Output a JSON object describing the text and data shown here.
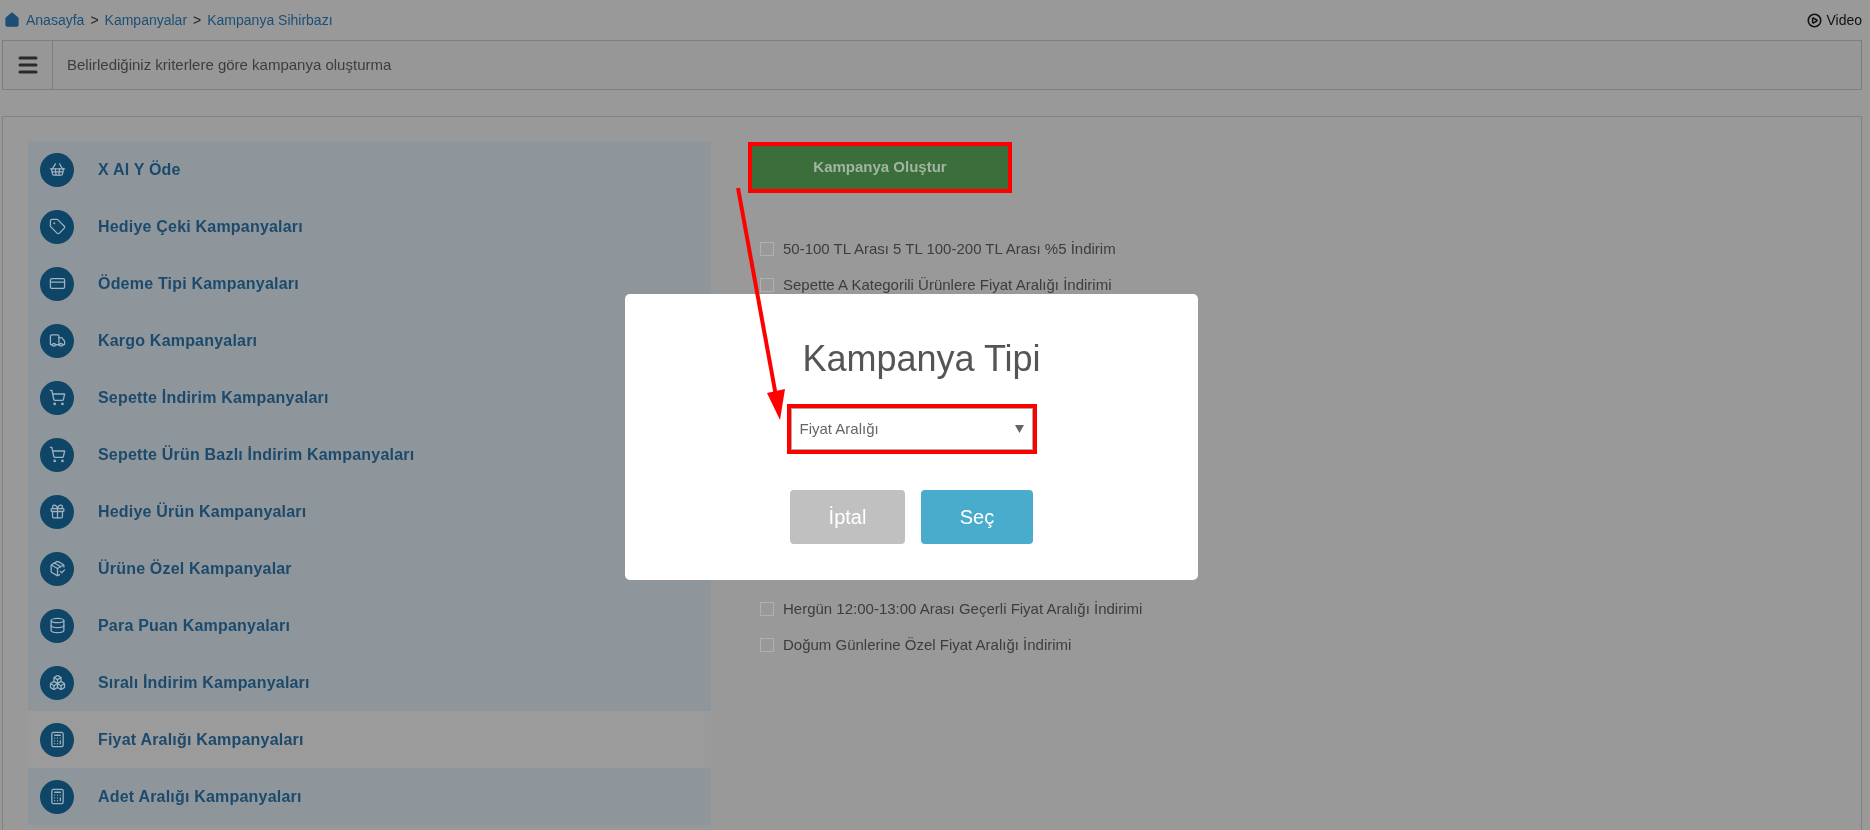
{
  "breadcrumb": [
    {
      "label": "Anasayfa"
    },
    {
      "label": "Kampanyalar"
    },
    {
      "label": "Kampanya Sihirbazı"
    }
  ],
  "breadcrumb_separator": ">",
  "video_link": "Video",
  "header": {
    "title": "Belirlediğiniz kriterlere göre kampanya oluşturma"
  },
  "sidebar": {
    "items": [
      {
        "label": "X Al Y Öde",
        "selected": false
      },
      {
        "label": "Hediye Çeki Kampanyaları",
        "selected": false
      },
      {
        "label": "Ödeme Tipi Kampanyaları",
        "selected": false
      },
      {
        "label": "Kargo Kampanyaları",
        "selected": false
      },
      {
        "label": "Sepette İndirim Kampanyaları",
        "selected": false
      },
      {
        "label": "Sepette Ürün Bazlı İndirim Kampanyaları",
        "selected": false
      },
      {
        "label": "Hediye Ürün Kampanyaları",
        "selected": false
      },
      {
        "label": "Ürüne Özel Kampanyalar",
        "selected": false
      },
      {
        "label": "Para Puan Kampanyaları",
        "selected": false
      },
      {
        "label": "Sıralı İndirim Kampanyaları",
        "selected": false
      },
      {
        "label": "Fiyat Aralığı Kampanyaları",
        "selected": true
      },
      {
        "label": "Adet Aralığı Kampanyaları",
        "selected": false
      }
    ]
  },
  "create_button": "Kampanya Oluştur",
  "campaigns_top": [
    {
      "label": "50-100 TL Arası 5 TL 100-200 TL Arası %5 İndirim",
      "checked": false
    },
    {
      "label": "Sepette A Kategorili Ürünlere Fiyat Aralığı İndirimi",
      "checked": false
    }
  ],
  "campaigns_bottom": [
    {
      "label": "Hergün 12:00-13:00 Arası Geçerli Fiyat Aralığı İndirimi",
      "checked": false
    },
    {
      "label": "Doğum Günlerine Özel Fiyat Aralığı İndirimi",
      "checked": false
    }
  ],
  "modal": {
    "title": "Kampanya Tipi",
    "select_value": "Fiyat Aralığı",
    "cancel_button": "İptal",
    "confirm_button": "Seç"
  }
}
